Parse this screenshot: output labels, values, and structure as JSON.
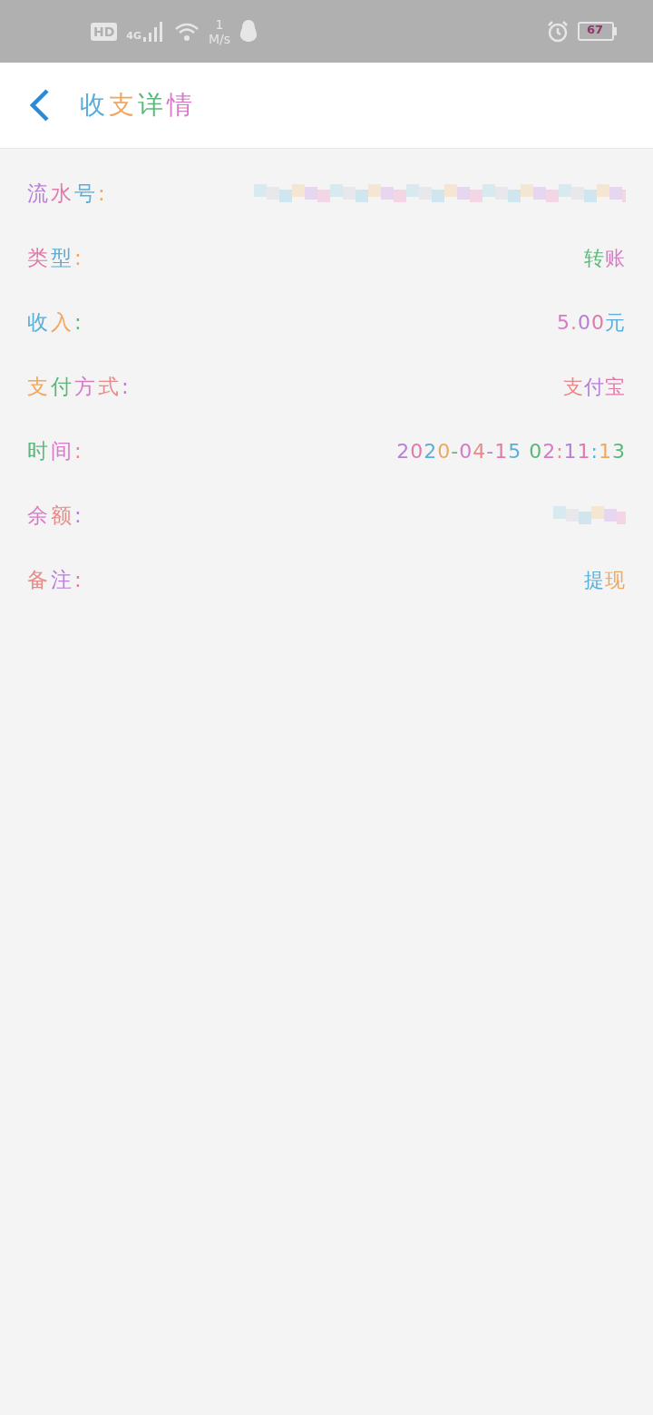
{
  "status_bar": {
    "hd": "HD",
    "network": "4G",
    "speed_value": "1",
    "speed_unit": "M/s",
    "battery": "67"
  },
  "header": {
    "title": "收支详情"
  },
  "details": [
    {
      "label": "流水号:",
      "kind": "redacted"
    },
    {
      "label": "类型:",
      "kind": "text",
      "value": "转账"
    },
    {
      "label": "收入:",
      "kind": "text",
      "value": "5.00元"
    },
    {
      "label": "支付方式:",
      "kind": "text",
      "value": "支付宝"
    },
    {
      "label": "时间:",
      "kind": "text",
      "value": "2020-04-15 02:11:13"
    },
    {
      "label": "余额:",
      "kind": "redacted",
      "short": true
    },
    {
      "label": "备注:",
      "kind": "text",
      "value": "提现"
    }
  ]
}
